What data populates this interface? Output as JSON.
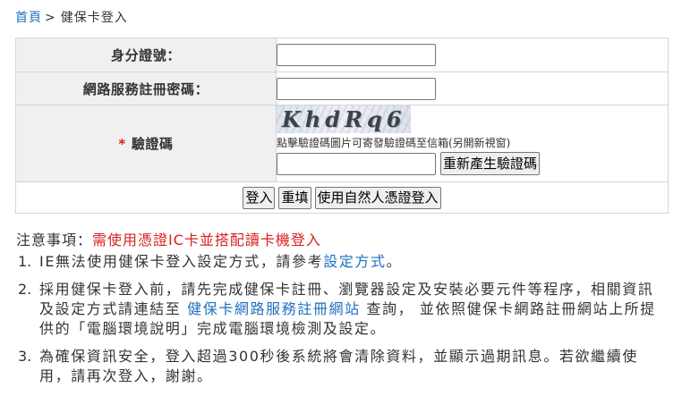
{
  "breadcrumb": {
    "home": "首頁",
    "separator": ">",
    "current": "健保卡登入"
  },
  "form": {
    "id_label": "身分證號：",
    "password_label": "網路服務註冊密碼：",
    "captcha_required_mark": "*",
    "captcha_label": "驗證碼",
    "captcha_image_text": "KhdRq6",
    "captcha_hint": "點擊驗證碼圖片可寄發驗證碼至信箱(另開新視窗)",
    "regenerate_button": "重新產生驗證碼",
    "login_button": "登入",
    "reset_button": "重填",
    "certificate_login_button": "使用自然人憑證登入"
  },
  "notice": {
    "title": "注意事項：",
    "highlight": "需使用憑證IC卡並搭配讀卡機登入",
    "items": [
      {
        "number": "1.",
        "before": "IE無法使用健保卡登入設定方式，請參考",
        "link": "設定方式",
        "after": "。"
      },
      {
        "number": "2.",
        "before": "採用健保卡登入前，請先完成健保卡註冊、瀏覽器設定及安裝必要元件等程序，相關資訊及設定方式請連結至 ",
        "link": "健保卡網路服務註冊網站",
        "after": " 查詢， 並依照健保卡網路註冊網站上所提供的「電腦環境說明」完成電腦環境檢測及設定。"
      },
      {
        "number": "3.",
        "text": "為確保資訊安全，登入超過300秒後系統將會清除資料，並顯示過期訊息。若欲繼續使用，請再次登入，謝謝。"
      }
    ]
  },
  "colors": {
    "text": "#333333",
    "link": "#1f6fc1",
    "warning": "#d8211d",
    "label_background": "#f0f0f0",
    "border": "#d4d4d4"
  }
}
